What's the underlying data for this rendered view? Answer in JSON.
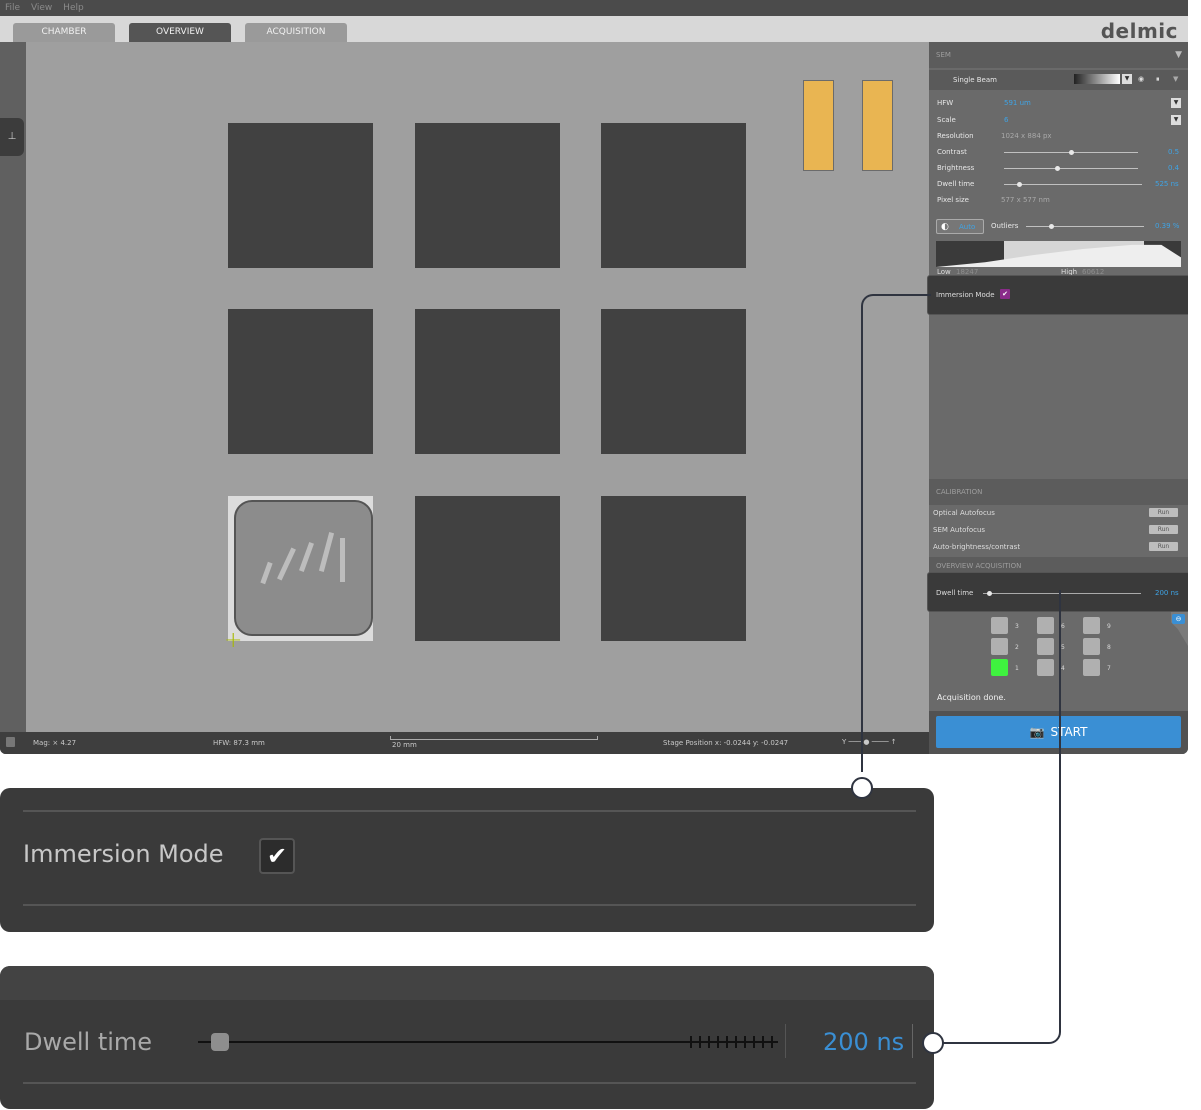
{
  "menu": [
    "File",
    "View",
    "Help"
  ],
  "tabs": [
    "CHAMBER",
    "OVERVIEW",
    "ACQUISITION"
  ],
  "logo": "delmic",
  "status": {
    "mag": "Mag: × 4.27",
    "hfw": "HFW: 87.3 mm",
    "scale": "20 mm",
    "stage": "Stage Position x: -0.0244 y: -0.0247"
  },
  "sem": {
    "header": "SEM",
    "stream": "Single Beam",
    "hfw_label": "HFW",
    "hfw_value": "591 um",
    "scale_label": "Scale",
    "scale_value": "6",
    "resolution_label": "Resolution",
    "resolution_value": "1024 x 884 px",
    "contrast_label": "Contrast",
    "contrast_value": "0.5",
    "brightness_label": "Brightness",
    "brightness_value": "0.4",
    "dwell_label": "Dwell time",
    "dwell_value": "525 ns",
    "pixel_label": "Pixel size",
    "pixel_value": "577 x 577 nm",
    "auto_label": "Auto",
    "outliers_label": "Outliers",
    "outliers_value": "0.39 %",
    "low_label": "Low",
    "low_value": "18247",
    "high_label": "High",
    "high_value": "60612"
  },
  "immersion": {
    "label": "Immersion Mode",
    "checked": true
  },
  "calibration": {
    "header": "CALIBRATION",
    "items": [
      "Optical Autofocus",
      "SEM Autofocus",
      "Auto-brightness/contrast"
    ],
    "run_label": "Run"
  },
  "overview_acq": {
    "header": "OVERVIEW ACQUISITION",
    "dwell_label": "Dwell time",
    "dwell_value": "200 ns",
    "grid": [
      "3",
      "6",
      "9",
      "2",
      "5",
      "8",
      "1",
      "4",
      "7"
    ],
    "done": "Acquisition done.",
    "start": "START"
  },
  "zoom_immersion": {
    "label": "Immersion Mode"
  },
  "zoom_dwell": {
    "label": "Dwell time",
    "value": "200 ns"
  },
  "colors": {
    "accent": "#3a8fd4",
    "value_blue": "#3fa3e4",
    "grid_done": "#3ff23f",
    "bar_orange": "#e9b552"
  }
}
